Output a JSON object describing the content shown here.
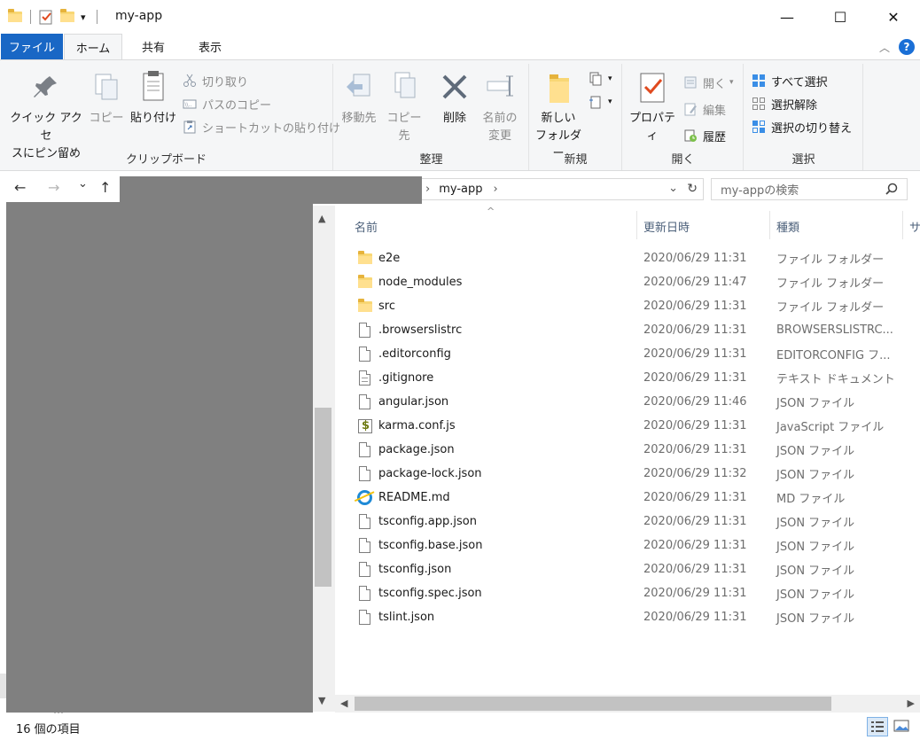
{
  "window": {
    "title": "my-app",
    "minimize": "—",
    "maximize": "☐",
    "close": "✕"
  },
  "qat": {
    "dropdown": "▾"
  },
  "ribbon_tabs": {
    "file": "ファイル",
    "home": "ホーム",
    "share": "共有",
    "view": "表示",
    "collapse": "︿",
    "help": "?"
  },
  "clipboard": {
    "label": "クリップボード",
    "pin_line1": "クイック アクセ",
    "pin_line2": "スにピン留め",
    "copy": "コピー",
    "paste": "貼り付け",
    "cut": "切り取り",
    "copy_path": "パスのコピー",
    "paste_shortcut": "ショートカットの貼り付け"
  },
  "organize": {
    "label": "整理",
    "move_to": "移動先",
    "copy_to": "コピー先",
    "delete": "削除",
    "rename_line1": "名前の",
    "rename_line2": "変更"
  },
  "new": {
    "label": "新規",
    "new_folder_line1": "新しい",
    "new_folder_line2": "フォルダー"
  },
  "open": {
    "label": "開く",
    "properties": "プロパティ",
    "open": "開く",
    "edit": "編集",
    "history": "履歴"
  },
  "select": {
    "label": "選択",
    "select_all": "すべて選択",
    "select_none": "選択解除",
    "invert": "選択の切り替え"
  },
  "nav": {
    "back": "←",
    "forward": "→",
    "recent": "⌄",
    "up": "↑",
    "breadcrumb_sep": "›",
    "breadcrumb_current": "my-app",
    "refresh": "↻",
    "search_placeholder": "my-appの検索",
    "nav_peek": "…"
  },
  "columns": {
    "name": "名前",
    "modified": "更新日時",
    "type": "種類",
    "size": "サ",
    "sort_caret": "^"
  },
  "files": [
    {
      "name": "e2e",
      "date": "2020/06/29 11:31",
      "type": "ファイル フォルダー",
      "icon": "folder-icon"
    },
    {
      "name": "node_modules",
      "date": "2020/06/29 11:47",
      "type": "ファイル フォルダー",
      "icon": "folder-icon"
    },
    {
      "name": "src",
      "date": "2020/06/29 11:31",
      "type": "ファイル フォルダー",
      "icon": "folder-icon"
    },
    {
      "name": ".browserslistrc",
      "date": "2020/06/29 11:31",
      "type": "BROWSERSLISTRC...",
      "icon": "file-icon"
    },
    {
      "name": ".editorconfig",
      "date": "2020/06/29 11:31",
      "type": "EDITORCONFIG フ...",
      "icon": "file-icon"
    },
    {
      "name": ".gitignore",
      "date": "2020/06/29 11:31",
      "type": "テキスト ドキュメント",
      "icon": "text-file-icon"
    },
    {
      "name": "angular.json",
      "date": "2020/06/29 11:46",
      "type": "JSON ファイル",
      "icon": "file-icon"
    },
    {
      "name": "karma.conf.js",
      "date": "2020/06/29 11:31",
      "type": "JavaScript ファイル",
      "icon": "javascript-file-icon"
    },
    {
      "name": "package.json",
      "date": "2020/06/29 11:31",
      "type": "JSON ファイル",
      "icon": "file-icon"
    },
    {
      "name": "package-lock.json",
      "date": "2020/06/29 11:32",
      "type": "JSON ファイル",
      "icon": "file-icon"
    },
    {
      "name": "README.md",
      "date": "2020/06/29 11:31",
      "type": "MD ファイル",
      "icon": "internet-explorer-icon"
    },
    {
      "name": "tsconfig.app.json",
      "date": "2020/06/29 11:31",
      "type": "JSON ファイル",
      "icon": "file-icon"
    },
    {
      "name": "tsconfig.base.json",
      "date": "2020/06/29 11:31",
      "type": "JSON ファイル",
      "icon": "file-icon"
    },
    {
      "name": "tsconfig.json",
      "date": "2020/06/29 11:31",
      "type": "JSON ファイル",
      "icon": "file-icon"
    },
    {
      "name": "tsconfig.spec.json",
      "date": "2020/06/29 11:31",
      "type": "JSON ファイル",
      "icon": "file-icon"
    },
    {
      "name": "tslint.json",
      "date": "2020/06/29 11:31",
      "type": "JSON ファイル",
      "icon": "file-icon"
    }
  ],
  "scroll": {
    "up": "▲",
    "down": "▼",
    "left": "◀",
    "right": "▶"
  },
  "status": {
    "count": "16 個の項目"
  },
  "colors": {
    "accent": "#1967c5",
    "redaction": "#808080",
    "ribbon_bg": "#f5f6f7"
  }
}
